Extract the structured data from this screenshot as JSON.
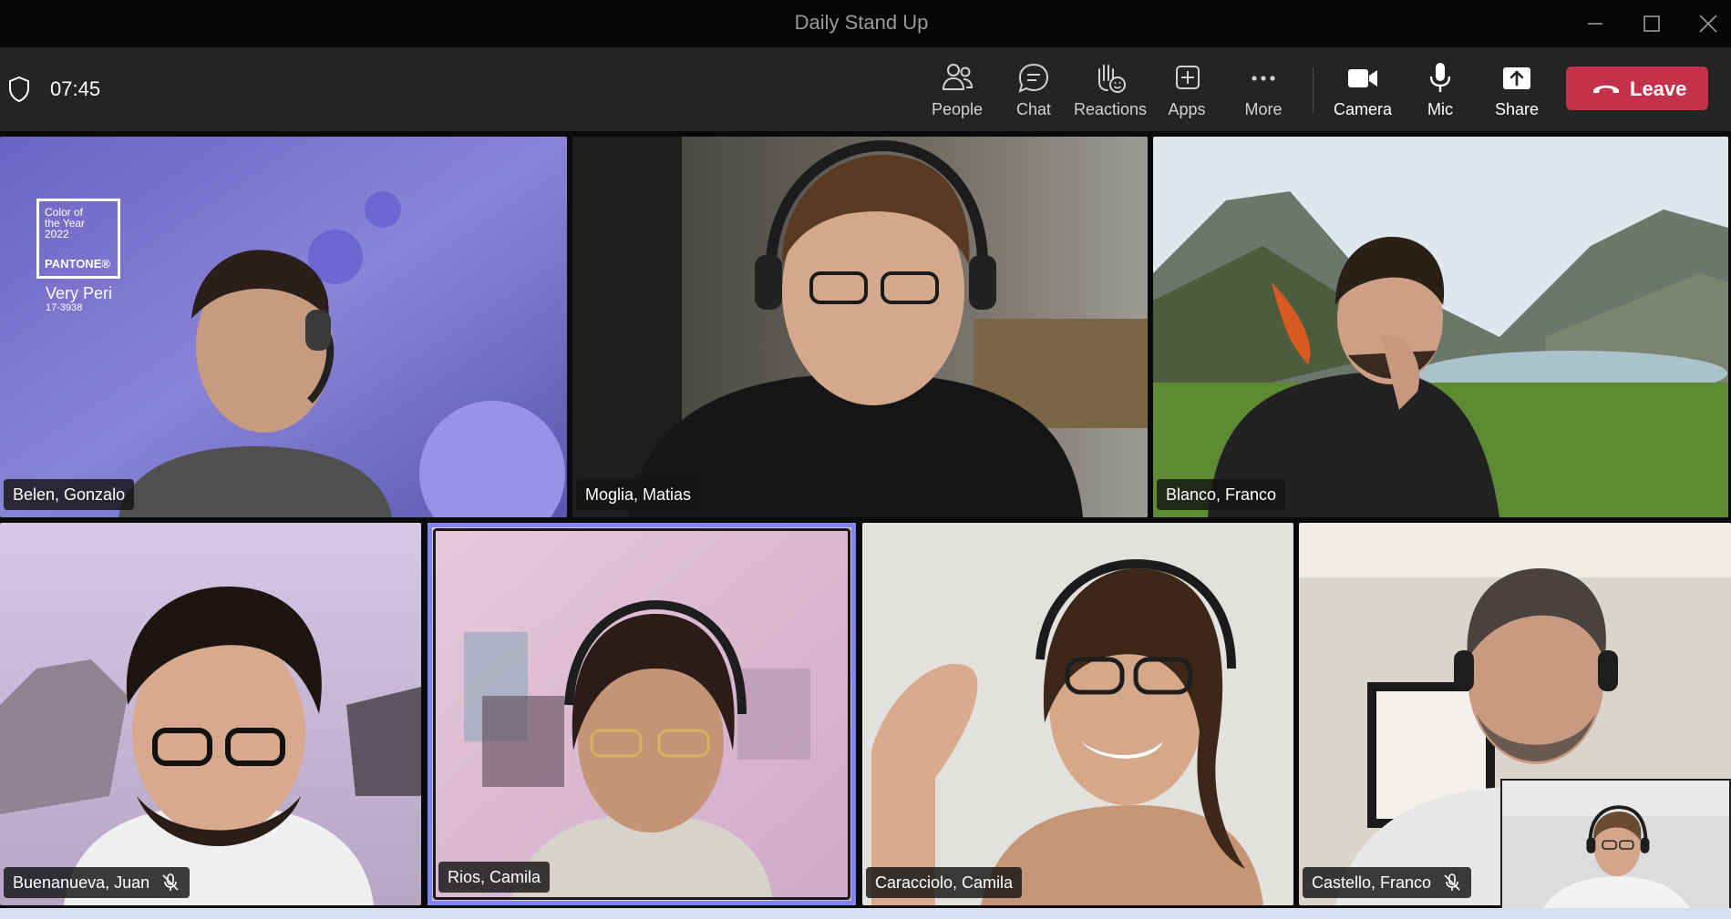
{
  "window": {
    "title": "Daily Stand Up"
  },
  "meeting": {
    "timer": "07:45"
  },
  "toolbar": {
    "people": "People",
    "chat": "Chat",
    "reactions": "Reactions",
    "apps": "Apps",
    "more": "More",
    "camera": "Camera",
    "mic": "Mic",
    "share": "Share",
    "leave": "Leave"
  },
  "participants": [
    {
      "name": "Belen, Gonzalo",
      "muted": false,
      "speaking": false
    },
    {
      "name": "Moglia, Matias",
      "muted": false,
      "speaking": false
    },
    {
      "name": "Blanco, Franco",
      "muted": false,
      "speaking": false
    },
    {
      "name": "Buenanueva, Juan",
      "muted": true,
      "speaking": false
    },
    {
      "name": "Rios, Camila",
      "muted": false,
      "speaking": true
    },
    {
      "name": "Caracciolo, Camila",
      "muted": false,
      "speaking": false
    },
    {
      "name": "Castello, Franco",
      "muted": true,
      "speaking": false
    }
  ],
  "pantone_card": {
    "line1": "Color of",
    "line2": "the Year",
    "line3": "2022",
    "brand": "PANTONE®",
    "color_name": "Very Peri",
    "color_code": "17-3938"
  },
  "colors": {
    "leave": "#c4314b",
    "speaking_border": "#7f85f5"
  }
}
